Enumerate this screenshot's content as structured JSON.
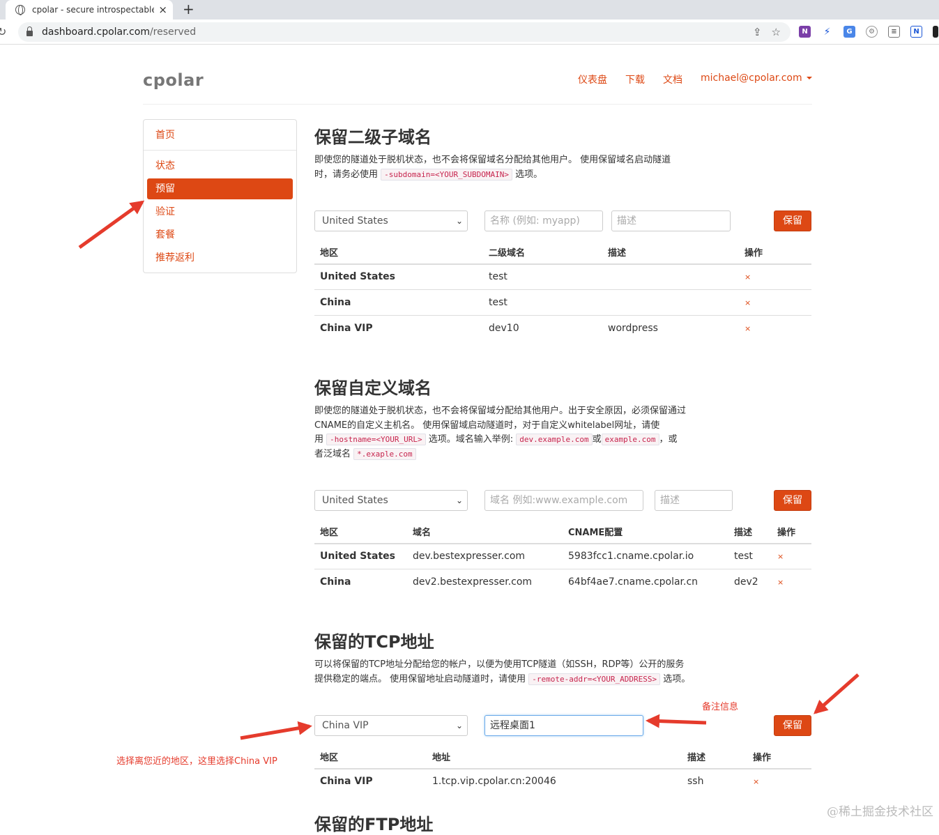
{
  "browser": {
    "tab_title": "cpolar - secure introspectable",
    "tab_close": "×",
    "new_tab": "+",
    "url_host": "dashboard.cpolar.com",
    "url_path": "/reserved"
  },
  "header": {
    "brand": "cpolar",
    "nav": [
      "仪表盘",
      "下载",
      "文档"
    ],
    "user": "michael@cpolar.com"
  },
  "sidebar": {
    "items": [
      {
        "label": "首页"
      },
      {
        "label": "状态"
      },
      {
        "label": "预留",
        "active": true
      },
      {
        "label": "验证"
      },
      {
        "label": "套餐"
      },
      {
        "label": "推荐返利"
      }
    ]
  },
  "subdomain": {
    "title": "保留二级子域名",
    "desc_1": "即使您的隧道处于脱机状态，也不会将保留域名分配给其他用户。 使用保留域名启动隧道",
    "desc_2a": "时，请务必使用",
    "code": "-subdomain=<YOUR_SUBDOMAIN>",
    "desc_2b": "选项。",
    "region": "United States",
    "name_placeholder": "名称 (例如: myapp)",
    "desc_placeholder": "描述",
    "save": "保留",
    "headers": [
      "地区",
      "二级域名",
      "描述",
      "操作"
    ],
    "rows": [
      {
        "region": "United States",
        "name": "test",
        "desc": "",
        "op": "×"
      },
      {
        "region": "China",
        "name": "test",
        "desc": "",
        "op": "×"
      },
      {
        "region": "China VIP",
        "name": "dev10",
        "desc": "wordpress",
        "op": "×"
      }
    ]
  },
  "custom": {
    "title": "保留自定义域名",
    "desc_1": "即使您的隧道处于脱机状态，也不会将保留域分配给其他用户。出于安全原因，必须保留通过",
    "desc_2": "CNAME的自定义主机名。 使用保留域启动隧道时，对于自定义whitelabel网址，请使",
    "desc_3a": "用",
    "code_1": "-hostname=<YOUR_URL>",
    "desc_3b": "选项。域名输入举例:",
    "code_2": "dev.example.com",
    "desc_3c": "或",
    "code_3": "example.com",
    "desc_3d": "，或",
    "desc_4": "者泛域名",
    "code_4": "*.exaple.com",
    "region": "United States",
    "domain_placeholder": "域名 例如:www.example.com",
    "desc_placeholder": "描述",
    "save": "保留",
    "headers": [
      "地区",
      "域名",
      "CNAME配置",
      "描述",
      "操作"
    ],
    "rows": [
      {
        "region": "United States",
        "domain": "dev.bestexpresser.com",
        "cname": "5983fcc1.cname.cpolar.io",
        "desc": "test",
        "op": "×"
      },
      {
        "region": "China",
        "domain": "dev2.bestexpresser.com",
        "cname": "64bf4ae7.cname.cpolar.cn",
        "desc": "dev2",
        "op": "×"
      }
    ]
  },
  "tcp": {
    "title": "保留的TCP地址",
    "desc_1": "可以将保留的TCP地址分配给您的帐户，以便为使用TCP隧道（如SSH，RDP等）公开的服务",
    "desc_2a": "提供稳定的端点。 使用保留地址启动隧道时，请使用",
    "code": "-remote-addr=<YOUR_ADDRESS>",
    "desc_2b": "选项。",
    "region": "China VIP",
    "desc_value": "远程桌面1",
    "save": "保留",
    "headers": [
      "地区",
      "地址",
      "描述",
      "操作"
    ],
    "rows": [
      {
        "region": "China VIP",
        "addr": "1.tcp.vip.cpolar.cn:20046",
        "desc": "ssh",
        "op": "×"
      }
    ]
  },
  "ftp": {
    "title": "保留的FTP地址"
  },
  "annotations": {
    "note": "备注信息",
    "region_tip": "选择离您近的地区，这里选择China VIP"
  },
  "watermark": "@稀土掘金技术社区",
  "colors": {
    "accent": "#dd4814",
    "annotation": "#e53b2c"
  }
}
